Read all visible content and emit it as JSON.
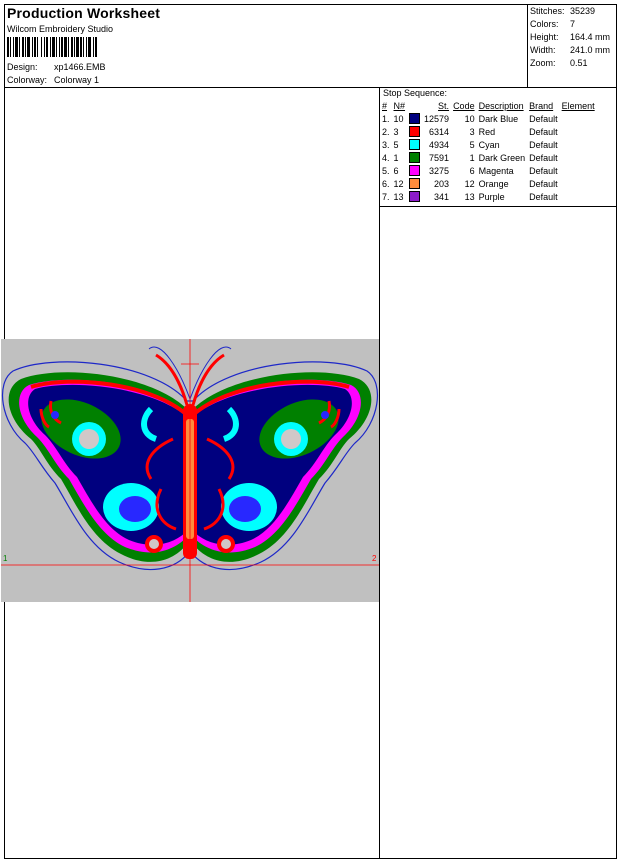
{
  "header": {
    "title": "Production Worksheet",
    "software": "Wilcom Embroidery Studio",
    "design_label": "Design:",
    "design_value": "xp1466.EMB",
    "colorway_label": "Colorway:",
    "colorway_value": "Colorway 1"
  },
  "stats": [
    {
      "label": "Stitches:",
      "value": "35239"
    },
    {
      "label": "Colors:",
      "value": "7"
    },
    {
      "label": "Height:",
      "value": "164.4 mm"
    },
    {
      "label": "Width:",
      "value": "241.0 mm"
    },
    {
      "label": "Zoom:",
      "value": "0.51"
    }
  ],
  "stop_sequence": {
    "title": "Stop Sequence:",
    "headers": [
      "#",
      "N#",
      "St.",
      "Code",
      "Description",
      "Brand",
      "Element"
    ],
    "rows": [
      {
        "idx": "1.",
        "n": "10",
        "color": "#00007f",
        "st": "12579",
        "code": "10",
        "desc": "Dark Blue",
        "brand": "Default",
        "element": ""
      },
      {
        "idx": "2.",
        "n": "3",
        "color": "#ff0000",
        "st": "6314",
        "code": "3",
        "desc": "Red",
        "brand": "Default",
        "element": ""
      },
      {
        "idx": "3.",
        "n": "5",
        "color": "#00ffff",
        "st": "4934",
        "code": "5",
        "desc": "Cyan",
        "brand": "Default",
        "element": ""
      },
      {
        "idx": "4.",
        "n": "1",
        "color": "#008000",
        "st": "7591",
        "code": "1",
        "desc": "Dark Green",
        "brand": "Default",
        "element": ""
      },
      {
        "idx": "5.",
        "n": "6",
        "color": "#ff00ff",
        "st": "3275",
        "code": "6",
        "desc": "Magenta",
        "brand": "Default",
        "element": ""
      },
      {
        "idx": "6.",
        "n": "12",
        "color": "#ff8c3c",
        "st": "203",
        "code": "12",
        "desc": "Orange",
        "brand": "Default",
        "element": ""
      },
      {
        "idx": "7.",
        "n": "13",
        "color": "#8c1cc8",
        "st": "341",
        "code": "13",
        "desc": "Purple",
        "brand": "Default",
        "element": ""
      }
    ]
  },
  "preview": {
    "marker_left": "1",
    "marker_right": "2",
    "colors": {
      "background": "#c0c0c0",
      "outline": "#1e28c8",
      "guide": "#ff0000",
      "dark_blue": "#00007f",
      "red": "#ff0000",
      "cyan": "#00ffff",
      "green": "#008000",
      "magenta": "#ff00ff",
      "orange": "#ff8c3c",
      "light_blue": "#2828ff",
      "spot": "#d0c8c8"
    }
  }
}
